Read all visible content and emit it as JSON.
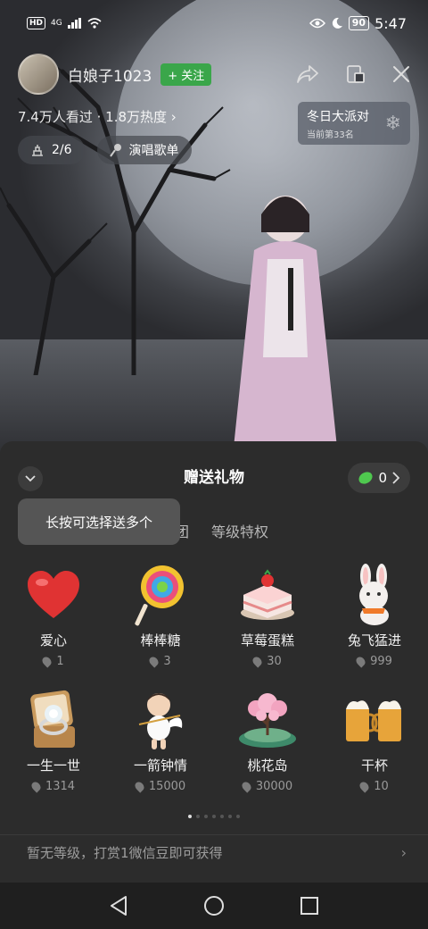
{
  "status_bar": {
    "hd": "HD",
    "net": "4G",
    "battery": "90",
    "time": "5:47"
  },
  "live": {
    "host_name": "白娘子1023",
    "follow_label": "+ 关注",
    "stats": "7.4万人看过 · 1.8万热度",
    "rank_title": "冬日大派对",
    "rank_sub": "当前第33名",
    "fans_count": "2/6",
    "song_list_label": "演唱歌单"
  },
  "panel": {
    "title": "赠送礼物",
    "balance": "0",
    "tooltip": "长按可选择送多个",
    "tabs": [
      "团",
      "等级特权"
    ],
    "gifts": [
      {
        "name": "爱心",
        "price": "1",
        "icon": "heart-icon"
      },
      {
        "name": "棒棒糖",
        "price": "3",
        "icon": "lollipop-icon"
      },
      {
        "name": "草莓蛋糕",
        "price": "30",
        "icon": "cake-icon"
      },
      {
        "name": "兔飞猛进",
        "price": "999",
        "icon": "rabbit-icon"
      },
      {
        "name": "一生一世",
        "price": "1314",
        "icon": "ring-icon"
      },
      {
        "name": "一箭钟情",
        "price": "15000",
        "icon": "cupid-icon"
      },
      {
        "name": "桃花岛",
        "price": "30000",
        "icon": "blossom-island-icon"
      },
      {
        "name": "干杯",
        "price": "10",
        "icon": "beer-icon"
      }
    ],
    "level_text": "暂无等级，打赏1微信豆即可获得"
  },
  "colors": {
    "accent_green": "#3aa64a",
    "bean_green": "#4fc84f",
    "panel_bg": "#2c2c2c"
  }
}
